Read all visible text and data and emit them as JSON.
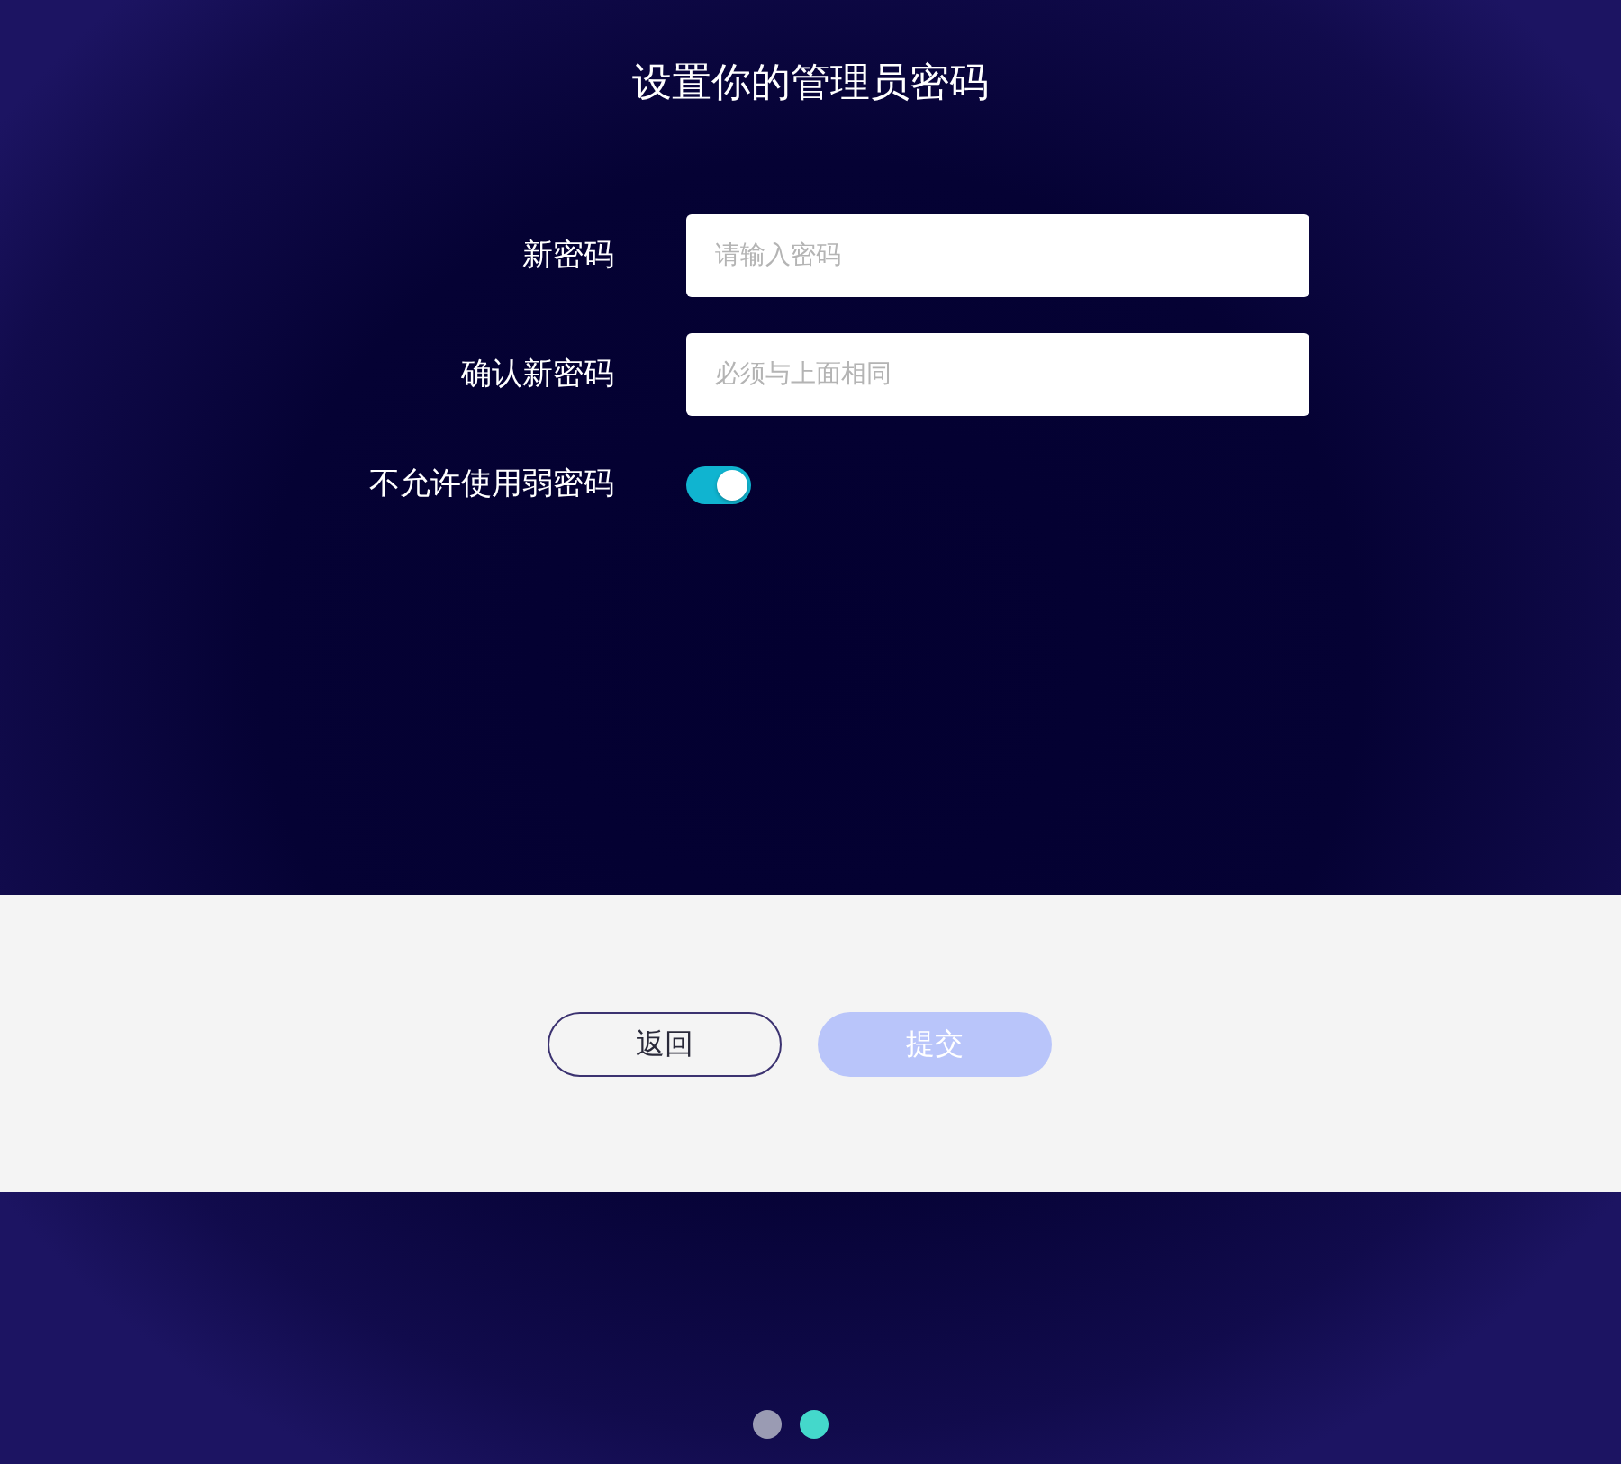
{
  "title": "设置你的管理员密码",
  "fields": [
    {
      "label": "新密码",
      "placeholder": "请输入密码"
    },
    {
      "label": "确认新密码",
      "placeholder": "必须与上面相同"
    }
  ],
  "weak_password_toggle": {
    "label": "不允许使用弱密码",
    "on": true
  },
  "buttons": [
    {
      "label": "返回",
      "kind": "outline",
      "disabled": false
    },
    {
      "label": "提交",
      "kind": "primary",
      "disabled": true
    }
  ],
  "pager": [
    {
      "selected": false
    },
    {
      "selected": true
    }
  ]
}
